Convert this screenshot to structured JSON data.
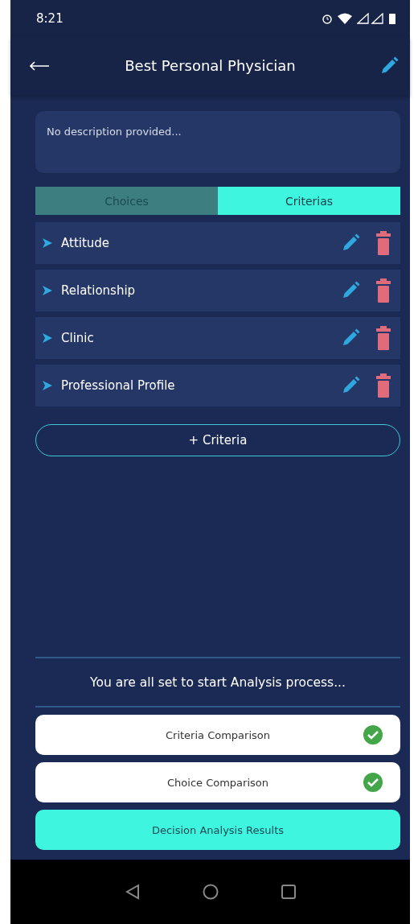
{
  "status_bar": {
    "time": "8:21"
  },
  "header": {
    "title": "Best Personal Physician"
  },
  "description": {
    "placeholder": "No description provided..."
  },
  "tabs": [
    {
      "label": "Choices",
      "selected": false
    },
    {
      "label": "Criterias",
      "selected": true
    }
  ],
  "criteria": [
    {
      "name": "Attitude"
    },
    {
      "name": "Relationship"
    },
    {
      "name": "Clinic"
    },
    {
      "name": "Professional Profile"
    }
  ],
  "add_button": "+ Criteria",
  "message": "You are all set to start Analysis process...",
  "steps": [
    {
      "label": "Criteria Comparison",
      "kind": "check",
      "completed": true
    },
    {
      "label": "Choice Comparison",
      "kind": "check",
      "completed": true
    },
    {
      "label": "Decision Analysis Results",
      "kind": "action"
    }
  ]
}
